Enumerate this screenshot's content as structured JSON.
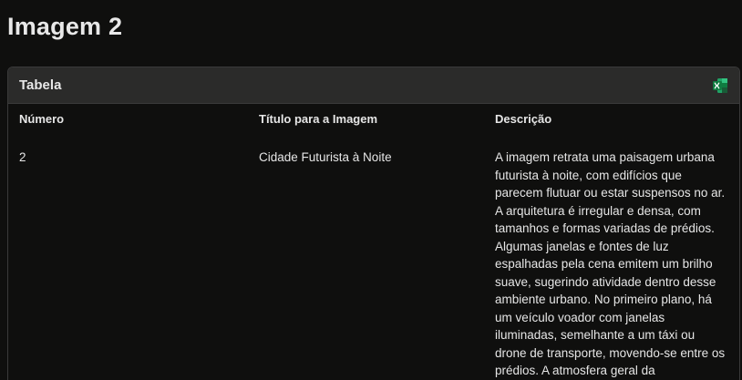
{
  "page": {
    "title": "Imagem 2"
  },
  "card": {
    "title": "Tabela",
    "export_icon": "excel-icon",
    "export_icon_color": "#1f9d55"
  },
  "table": {
    "headers": [
      "Número",
      "Título para a Imagem",
      "Descrição"
    ],
    "rows": [
      {
        "numero": "2",
        "titulo": "Cidade Futurista à Noite",
        "descricao": "A imagem retrata uma paisagem urbana futurista à noite, com edifícios que parecem flutuar ou estar suspensos no ar. A arquitetura é irregular e densa, com tamanhos e formas variadas de prédios. Algumas janelas e fontes de luz espalhadas pela cena emitem um brilho suave, sugerindo atividade dentro desse ambiente urbano. No primeiro plano, há um veículo voador com janelas iluminadas, semelhante a um táxi ou drone de transporte, movendo-se entre os prédios. A atmosfera geral da"
      }
    ]
  }
}
